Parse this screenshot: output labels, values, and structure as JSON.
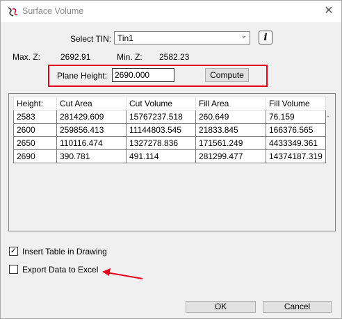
{
  "window": {
    "title": "Surface Volume",
    "close_glyph": "✕"
  },
  "tin": {
    "label": "Select TIN:",
    "value": "Tin1"
  },
  "stats": {
    "max_label": "Max. Z:",
    "max_value": "2692.91",
    "min_label": "Min. Z:",
    "min_value": "2582.23"
  },
  "plane": {
    "label": "Plane Height:",
    "value": "2690.000",
    "compute_label": "Compute"
  },
  "table": {
    "headers": [
      "Height:",
      "Cut Area",
      "Cut Volume",
      "Fill Area",
      "Fill Volume"
    ],
    "rows": [
      [
        "2583",
        "281429.609",
        "15767237.518",
        "260.649",
        "76.159"
      ],
      [
        "2600",
        "259856.413",
        "11144803.545",
        "21833.845",
        "166376.565"
      ],
      [
        "2650",
        "110116.474",
        "1327278.836",
        "171561.249",
        "4433349.361"
      ],
      [
        "2690",
        "390.781",
        "491.114",
        "281299.477",
        "14374187.319"
      ]
    ]
  },
  "options": {
    "insert_table_label": "Insert Table in Drawing",
    "insert_table_checked": true,
    "export_excel_label": "Export Data to Excel",
    "export_excel_checked": false
  },
  "footer": {
    "ok_label": "OK",
    "cancel_label": "Cancel"
  },
  "colors": {
    "highlight": "#e3001b"
  }
}
